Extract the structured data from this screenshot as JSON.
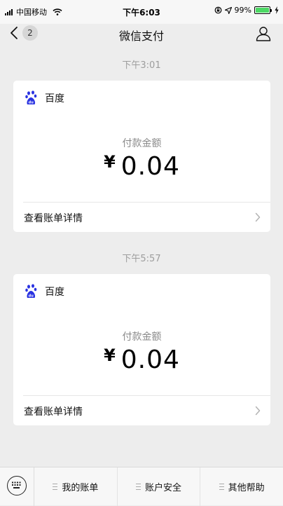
{
  "status_bar": {
    "carrier": "中国移动",
    "time": "下午6:03",
    "battery_percent": "99%",
    "battery_level": 0.99,
    "icons": [
      "signal-bars-icon",
      "wifi-icon",
      "lock-rotation-icon",
      "location-arrow-icon",
      "battery-icon",
      "charging-bolt-icon"
    ],
    "colors": {
      "battery": "#4cd964"
    }
  },
  "nav": {
    "unread_count": "2",
    "title": "微信支付",
    "icons": [
      "back-chevron-icon",
      "profile-icon"
    ]
  },
  "messages": [
    {
      "timestamp": "下午3:01",
      "merchant": "百度",
      "merchant_icon": "baidu-paw-icon",
      "amount_label": "付款金额",
      "currency_symbol": "¥",
      "amount": "0.04",
      "detail_link": "查看账单详情"
    },
    {
      "timestamp": "下午5:57",
      "merchant": "百度",
      "merchant_icon": "baidu-paw-icon",
      "amount_label": "付款金额",
      "currency_symbol": "¥",
      "amount": "0.04",
      "detail_link": "查看账单详情"
    }
  ],
  "bottom_menu": {
    "keyboard_icon": "keyboard-icon",
    "items": [
      {
        "label": "我的账单",
        "icon": "menu-lines-icon"
      },
      {
        "label": "账户安全",
        "icon": "menu-lines-icon"
      },
      {
        "label": "其他帮助",
        "icon": "menu-lines-icon"
      }
    ]
  },
  "colors": {
    "background": "#ededed",
    "card": "#ffffff",
    "timestamp_text": "#9d9d9d",
    "baidu_blue": "#2932e1"
  }
}
